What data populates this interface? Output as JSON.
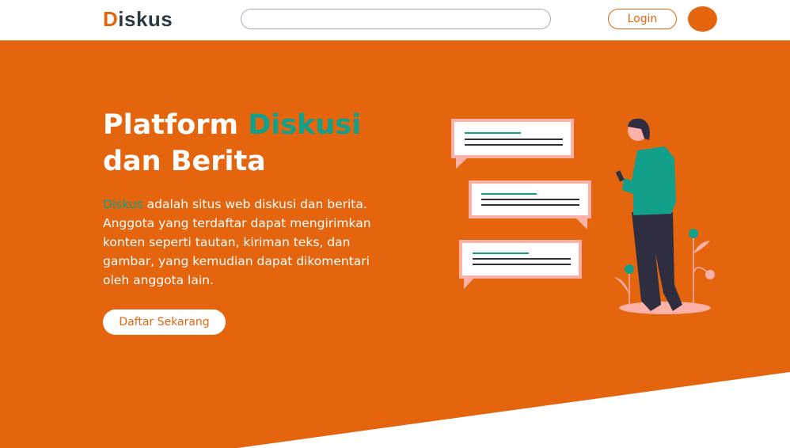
{
  "nav": {
    "logo_initial": "D",
    "logo_rest": "iskus",
    "search_placeholder": "",
    "login_label": "Login"
  },
  "hero": {
    "title_1": "Platform ",
    "title_highlight": "Diskusi",
    "title_2": "dan Berita",
    "desc_highlight": "Diskus",
    "desc_rest": " adalah situs web diskusi dan berita. Anggota yang terdaftar dapat mengirimkan konten seperti tautan, kiriman teks, dan gambar, yang kemudian dapat dikomentari oleh anggota lain.",
    "cta_label": "Daftar Sekarang"
  },
  "colors": {
    "accent": "#e5650e",
    "highlight": "#12a08a"
  }
}
